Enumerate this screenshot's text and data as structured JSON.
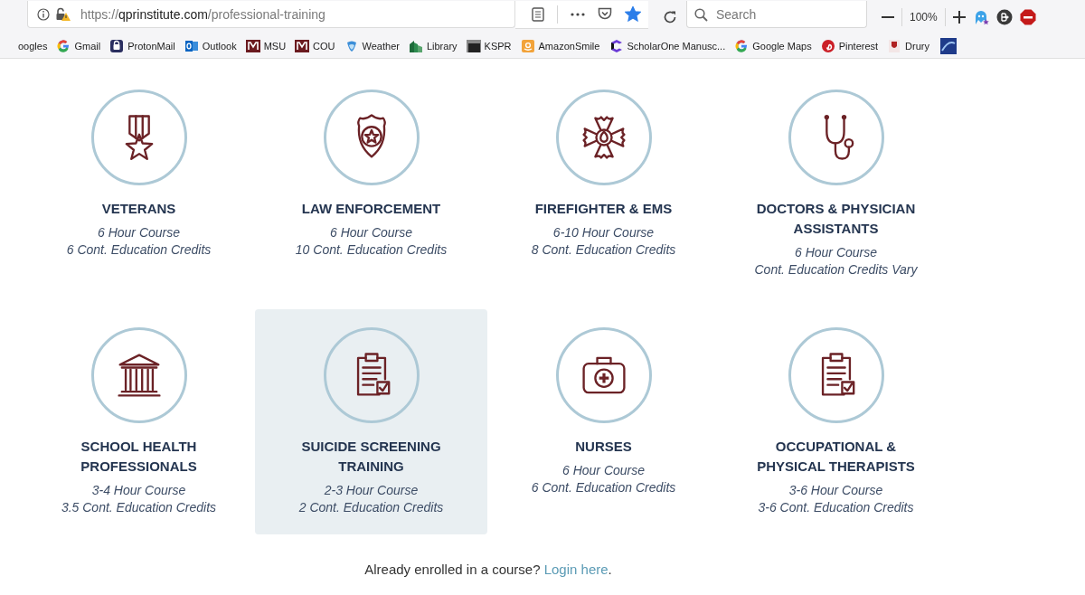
{
  "browser": {
    "url": {
      "scheme": "https://",
      "host": "qprinstitute.com",
      "path": "/professional-training"
    },
    "bookmarked": true,
    "search": {
      "placeholder": "Search"
    },
    "zoom": "100%"
  },
  "bookmarks": [
    {
      "label": "oogles",
      "kind": "plain"
    },
    {
      "label": "Gmail",
      "kind": "google"
    },
    {
      "label": "ProtonMail",
      "kind": "proton"
    },
    {
      "label": "Outlook",
      "kind": "outlook"
    },
    {
      "label": "MSU",
      "kind": "m"
    },
    {
      "label": "COU",
      "kind": "m"
    },
    {
      "label": "Weather",
      "kind": "weather"
    },
    {
      "label": "Library",
      "kind": "library"
    },
    {
      "label": "KSPR",
      "kind": "kspr"
    },
    {
      "label": "AmazonSmile",
      "kind": "amazon"
    },
    {
      "label": "ScholarOne Manusc...",
      "kind": "scholar"
    },
    {
      "label": "Google Maps",
      "kind": "google"
    },
    {
      "label": "Pinterest",
      "kind": "pinterest"
    },
    {
      "label": "Drury",
      "kind": "drury"
    },
    {
      "kind": "tile"
    }
  ],
  "courses": [
    {
      "kind": "medal",
      "title": "VETERANS",
      "lines": [
        "6 Hour Course",
        "6 Cont. Education Credits"
      ],
      "selected": false
    },
    {
      "kind": "badge",
      "title": "LAW ENFORCEMENT",
      "lines": [
        "6 Hour Course",
        "10 Cont. Education Credits"
      ],
      "selected": false
    },
    {
      "kind": "cross",
      "title": "FIREFIGHTER & EMS",
      "lines": [
        "6-10 Hour Course",
        "8 Cont. Education Credits"
      ],
      "selected": false
    },
    {
      "kind": "stethoscope",
      "title": "DOCTORS & PHYSICIAN ASSISTANTS",
      "lines": [
        "6 Hour Course",
        "Cont. Education Credits Vary"
      ],
      "selected": false
    },
    {
      "kind": "building",
      "title": "SCHOOL HEALTH PROFESSIONALS",
      "lines": [
        "3-4 Hour Course",
        "3.5 Cont. Education Credits"
      ],
      "selected": false
    },
    {
      "kind": "clipboard",
      "title": "SUICIDE SCREENING TRAINING",
      "lines": [
        "2-3 Hour Course",
        "2 Cont. Education Credits"
      ],
      "selected": true
    },
    {
      "kind": "medkit",
      "title": "NURSES",
      "lines": [
        "6 Hour Course",
        "6 Cont. Education Credits"
      ],
      "selected": false
    },
    {
      "kind": "clipboard",
      "title": "OCCUPATIONAL & PHYSICAL THERAPISTS",
      "lines": [
        "3-6 Hour Course",
        "3-6 Cont. Education Credits"
      ],
      "selected": false
    }
  ],
  "footer": {
    "text": "Already enrolled in a course?",
    "link": "Login here",
    "end": "."
  }
}
